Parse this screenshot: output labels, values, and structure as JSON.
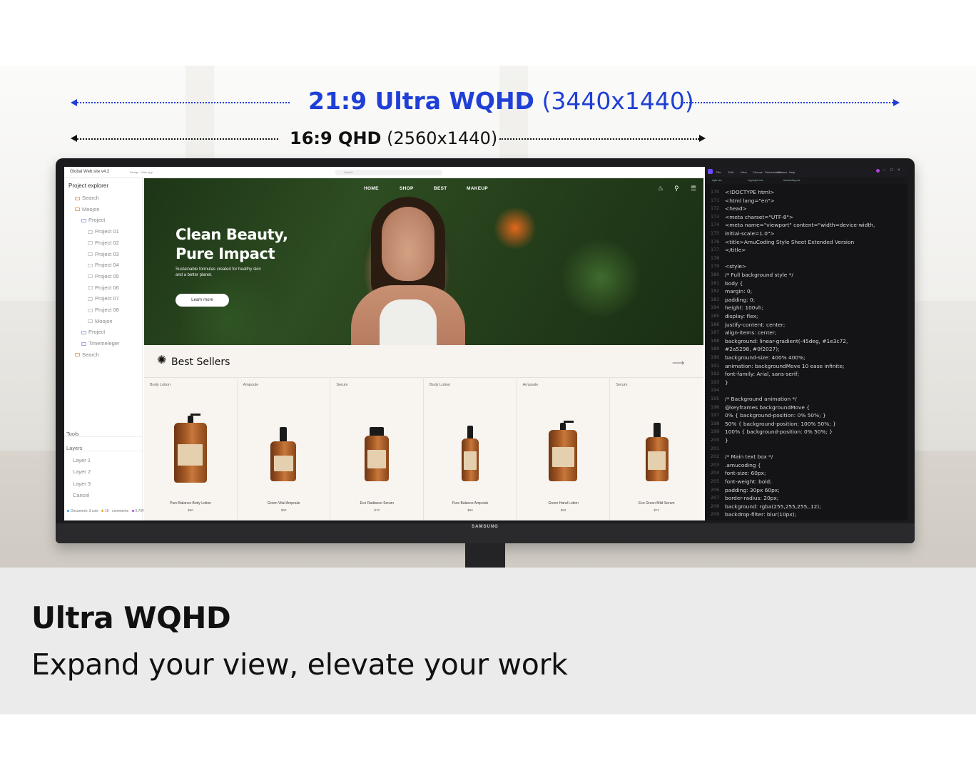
{
  "headline": {
    "ultra_bold": "21:9 Ultra WQHD",
    "ultra_res": "(3440x1440)",
    "qhd_bold": "16:9 QHD",
    "qhd_res": "(2560x1440)"
  },
  "colors": {
    "accent": "#1f3fd6",
    "text": "#111111",
    "band": "#ebebeb"
  },
  "monitor": {
    "brand": "SAMSUNG"
  },
  "ide": {
    "title": "Global Web site v4.2",
    "title_meta": "Design · Web app",
    "tab": "Search",
    "explorer": {
      "header": "Project explorer",
      "rows": [
        {
          "label": "Search",
          "indent": 1
        },
        {
          "label": "Moojon",
          "indent": 1
        },
        {
          "label": "Project",
          "indent": 2
        },
        {
          "label": "Project 01",
          "indent": 3
        },
        {
          "label": "Project 02",
          "indent": 3
        },
        {
          "label": "Project 03",
          "indent": 3
        },
        {
          "label": "Project 04",
          "indent": 3
        },
        {
          "label": "Project 05",
          "indent": 3
        },
        {
          "label": "Project 06",
          "indent": 3
        },
        {
          "label": "Project 07",
          "indent": 3
        },
        {
          "label": "Project 08",
          "indent": 3
        },
        {
          "label": "Moojon",
          "indent": 3
        },
        {
          "label": "Project",
          "indent": 2
        },
        {
          "label": "Timemeleger",
          "indent": 2
        },
        {
          "label": "Search",
          "indent": 1
        }
      ],
      "tools_label": "Tools",
      "layers_label": "Layers",
      "layers": [
        "Layer 1",
        "Layer 2",
        "Layer 3",
        "Cancel"
      ],
      "status": [
        "Document: 3 cols",
        "16 · comments",
        "0.70%"
      ]
    }
  },
  "site": {
    "nav": [
      "HOME",
      "SHOP",
      "BEST",
      "MAKEUP"
    ],
    "nav_icons": [
      "bell-icon",
      "search-icon",
      "menu-icon"
    ],
    "hero_title_1": "Clean Beauty,",
    "hero_title_2": "Pure Impact",
    "hero_sub": "Sustainable formulas created for healthy skin and a better planet.",
    "hero_button": "Learn more",
    "best_title": "Best Sellers",
    "products": [
      {
        "category": "Body Lotion",
        "name": "Pure Balance Body Lotion",
        "price": "$60",
        "shape": "pump-tall"
      },
      {
        "category": "Ampoule",
        "name": "Green Vital Ampoule",
        "price": "$60",
        "shape": "dropper-small"
      },
      {
        "category": "Serum",
        "name": "Eco Radiance Serum",
        "price": "$72",
        "shape": "serum"
      },
      {
        "category": "Body Lotion",
        "name": "Pure Balance Ampoule",
        "price": "$60",
        "shape": "dropper-thin"
      },
      {
        "category": "Ampoule",
        "name": "Green Hand Lotion",
        "price": "$60",
        "shape": "pump"
      },
      {
        "category": "Serum",
        "name": "Eco Green Mild Serum",
        "price": "$72",
        "shape": "dropper"
      }
    ]
  },
  "editor": {
    "menu": [
      "File",
      "Edit",
      "View",
      "Choose",
      "Performance",
      "Window",
      "Help"
    ],
    "tabs": [
      "style.css",
      "myproject.css",
      "amucoding.css"
    ],
    "lines": [
      {
        "n": "170",
        "c": "<!DOCTYPE html>",
        "k": "tag"
      },
      {
        "n": "171",
        "c": "<html lang=\"en\">",
        "k": "tag"
      },
      {
        "n": "172",
        "c": "<head>",
        "k": "tag"
      },
      {
        "n": "173",
        "c": "<meta charset=\"UTF-8\">",
        "k": "tag"
      },
      {
        "n": "174",
        "c": "<meta name=\"viewport\" content=\"width=device-width,",
        "k": "tag"
      },
      {
        "n": "175",
        "c": "initial-scale=1.0\">",
        "k": "tag"
      },
      {
        "n": "176",
        "c": "<title>AmuCoding Style Sheet Extended Version",
        "k": "plain"
      },
      {
        "n": "177",
        "c": "</title>",
        "k": "tag"
      },
      {
        "n": "178",
        "c": "",
        "k": "plain"
      },
      {
        "n": "179",
        "c": "<style>",
        "k": "tag"
      },
      {
        "n": "180",
        "c": " /* Full background style */",
        "k": "cmt"
      },
      {
        "n": "181",
        "c": " body {",
        "k": "sel"
      },
      {
        "n": "182",
        "c": "   margin: 0;",
        "k": "prop"
      },
      {
        "n": "183",
        "c": "   padding: 0;",
        "k": "prop"
      },
      {
        "n": "184",
        "c": "   height: 100vh;",
        "k": "prop"
      },
      {
        "n": "185",
        "c": "   display: flex;",
        "k": "prop"
      },
      {
        "n": "186",
        "c": "   justify-content: center;",
        "k": "prop"
      },
      {
        "n": "187",
        "c": "   align-items: center;",
        "k": "prop"
      },
      {
        "n": "188",
        "c": "   background: linear-gradient(-45deg, #1e3c72,",
        "k": "prop"
      },
      {
        "n": "189",
        "c": "#2a5298, #0f2027);",
        "k": "plain"
      },
      {
        "n": "190",
        "c": "   background-size: 400% 400%;",
        "k": "prop"
      },
      {
        "n": "191",
        "c": "   animation: backgroundMove 10 ease infinite;",
        "k": "prop"
      },
      {
        "n": "192",
        "c": "   font-family: Arial, sans-serif;",
        "k": "prop"
      },
      {
        "n": "193",
        "c": " }",
        "k": "plain"
      },
      {
        "n": "194",
        "c": "",
        "k": "plain"
      },
      {
        "n": "195",
        "c": " /* Background animation */",
        "k": "cmt"
      },
      {
        "n": "196",
        "c": " @keyframes backgroundMove {",
        "k": "kw"
      },
      {
        "n": "197",
        "c": "   0% { background-position: 0% 50%; }",
        "k": "prop"
      },
      {
        "n": "198",
        "c": "   50% { background-position: 100% 50%; }",
        "k": "prop"
      },
      {
        "n": "199",
        "c": "   100% { background-position: 0% 50%; }",
        "k": "prop"
      },
      {
        "n": "200",
        "c": " }",
        "k": "plain"
      },
      {
        "n": "201",
        "c": "",
        "k": "plain"
      },
      {
        "n": "202",
        "c": " /* Main text box */",
        "k": "cmt"
      },
      {
        "n": "203",
        "c": " .amucoding {",
        "k": "sel"
      },
      {
        "n": "204",
        "c": "   font-size: 60px;",
        "k": "prop"
      },
      {
        "n": "205",
        "c": "   font-weight: bold;",
        "k": "prop"
      },
      {
        "n": "206",
        "c": "   padding: 30px 60px;",
        "k": "prop"
      },
      {
        "n": "207",
        "c": "   border-radius: 20px;",
        "k": "prop"
      },
      {
        "n": "208",
        "c": "   background: rgba(255,255,255,.12);",
        "k": "prop"
      },
      {
        "n": "209",
        "c": "   backdrop-filter: blur(10px);",
        "k": "prop"
      }
    ]
  },
  "band": {
    "title": "Ultra WQHD",
    "subtitle": "Expand your view, elevate your work"
  }
}
